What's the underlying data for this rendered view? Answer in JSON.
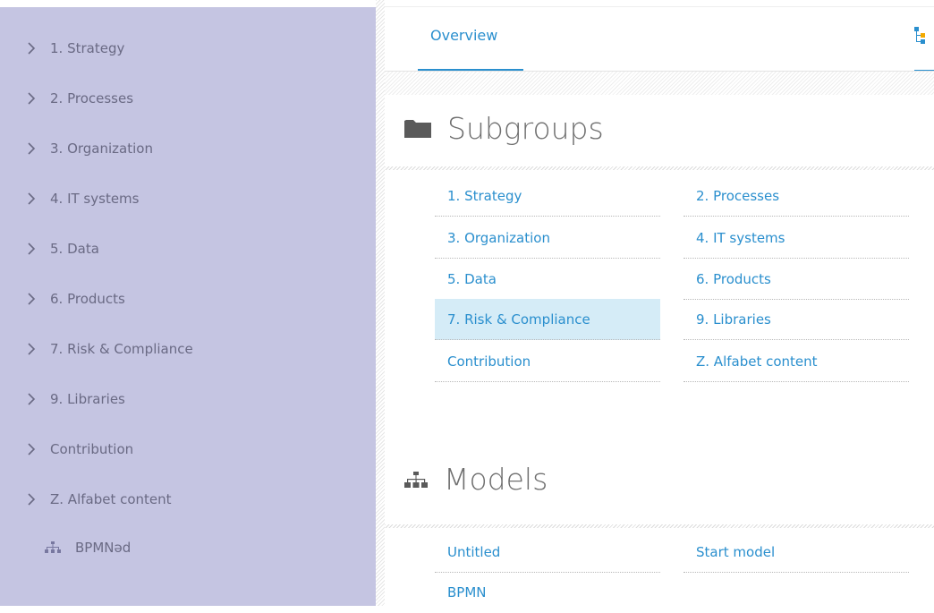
{
  "sidebar": {
    "items": [
      {
        "label": "1. Strategy"
      },
      {
        "label": "2. Processes"
      },
      {
        "label": "3. Organization"
      },
      {
        "label": "4. IT systems"
      },
      {
        "label": "5. Data"
      },
      {
        "label": "6. Products"
      },
      {
        "label": "7. Risk & Compliance"
      },
      {
        "label": "9. Libraries"
      },
      {
        "label": "Contribution"
      },
      {
        "label": "Z. Alfabet content"
      }
    ],
    "model_item": {
      "label": "BPMNəd",
      "icon": "model-hierarchy-icon"
    }
  },
  "tabs": {
    "overview": "Overview",
    "right_icon": "tree-view-icon"
  },
  "subgroups": {
    "title": "Subgroups",
    "icon": "folder-icon",
    "links": [
      [
        "1. Strategy",
        "2. Processes"
      ],
      [
        "3. Organization",
        "4. IT systems"
      ],
      [
        "5. Data",
        "6. Products"
      ],
      [
        "7. Risk & Compliance",
        "9. Libraries"
      ],
      [
        "Contribution",
        "Z. Alfabet content"
      ]
    ],
    "highlighted": "7. Risk & Compliance"
  },
  "models": {
    "title": "Models",
    "icon": "model-hierarchy-icon",
    "links": [
      [
        "Untitled",
        "Start model"
      ],
      [
        "BPMN",
        ""
      ]
    ]
  },
  "colors": {
    "sidebar_bg": "#c5c5e2",
    "accent": "#2a8fce",
    "highlight": "#d5ecf7"
  }
}
